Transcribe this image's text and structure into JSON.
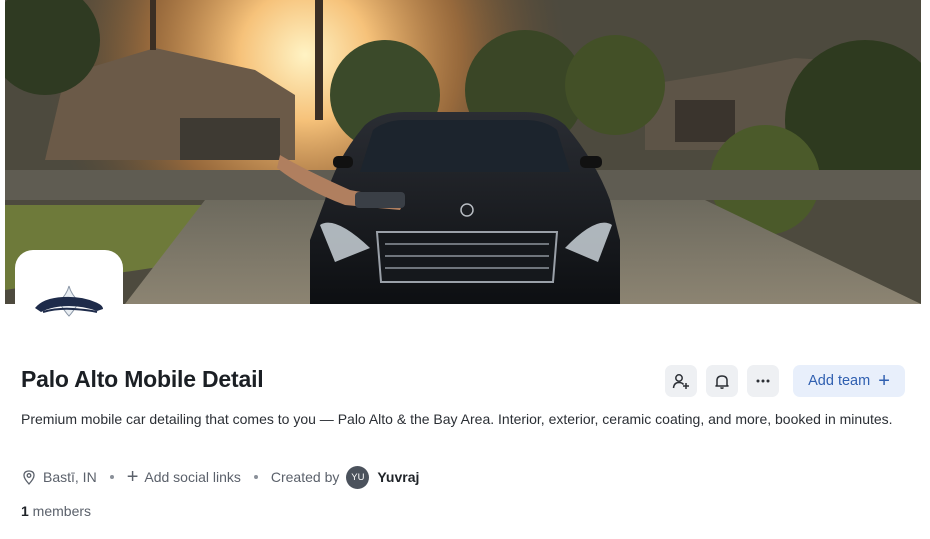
{
  "banner": {
    "alt_subject": ""
  },
  "group": {
    "title": "Palo Alto Mobile Detail",
    "description": "Premium mobile car detailing that comes to you — Palo Alto & the Bay Area. Interior, exterior, ceramic coating, and more, booked in minutes."
  },
  "actions": {
    "add_member_icon": "person-add-icon",
    "notifications_icon": "bell-icon",
    "more_icon": "ellipsis-icon",
    "add_team_label": "Add team"
  },
  "meta": {
    "location": "Bastī, IN",
    "add_social_label": "Add social links",
    "created_by_label": "Created by",
    "creator_initials": "YU",
    "creator_name": "Yuvraj"
  },
  "members": {
    "count": "1",
    "label": " members"
  },
  "colors": {
    "accent": "#2f5fb0",
    "accent_bg": "#e8effb",
    "icon_button_bg": "#eef0f3"
  }
}
